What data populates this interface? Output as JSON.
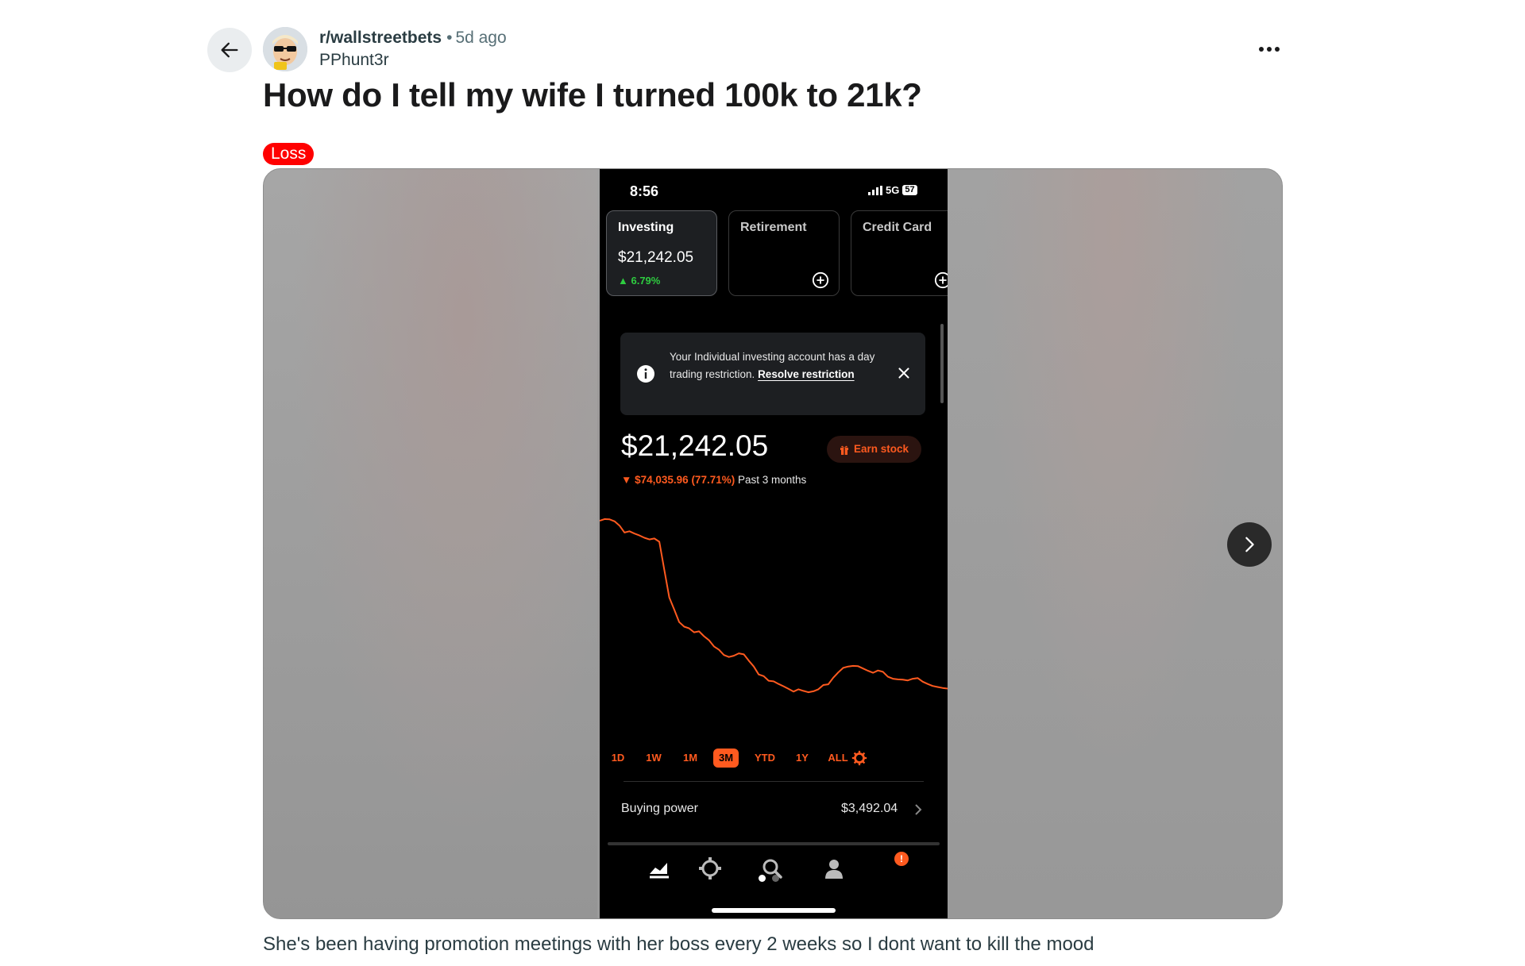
{
  "post": {
    "subreddit": "r/wallstreetbets",
    "separator": "•",
    "time_ago": "5d ago",
    "username": "PPhunt3r",
    "title": "How do I tell my wife I turned 100k to 21k?",
    "flair": "Loss",
    "body": "She's been having promotion meetings with her boss every 2 weeks so I dont want to kill the mood"
  },
  "icons": {
    "back": "arrow-left-icon",
    "more": "more-horizontal-icon",
    "next": "chevron-right-icon"
  },
  "phone": {
    "status_time": "8:56",
    "network": "5G",
    "battery": "57",
    "accounts": [
      {
        "label": "Investing",
        "value": "$21,242.05",
        "change": "▲ 6.79%"
      },
      {
        "label": "Retirement"
      },
      {
        "label": "Credit Card"
      }
    ],
    "notice": {
      "text": "Your Individual investing account has a day trading restriction.",
      "link": "Resolve restriction"
    },
    "balance": "$21,242.05",
    "earn_button": "Earn stock",
    "change_amount": "$74,035.96 (77.71%)",
    "change_period": "Past 3 months",
    "ranges": [
      "1D",
      "1W",
      "1M",
      "3M",
      "YTD",
      "1Y",
      "ALL"
    ],
    "selected_range": "3M",
    "buying_power_label": "Buying power",
    "buying_power_value": "$3,492.04",
    "notification_badge": "!",
    "accent_color": "#ff5a1f",
    "gain_color": "#2ecc40"
  },
  "chart_data": {
    "type": "line",
    "title": "",
    "xlabel": "",
    "ylabel": "",
    "period": "3M",
    "x": [
      0,
      1,
      2,
      3,
      4,
      5,
      6,
      7,
      8,
      9,
      10,
      11,
      12,
      13,
      14,
      15,
      16,
      17,
      18,
      19,
      20,
      21,
      22,
      23,
      24,
      25,
      26,
      27,
      28,
      29,
      30,
      31,
      32,
      33,
      34,
      35,
      36,
      37,
      38,
      39,
      40,
      41,
      42,
      43,
      44,
      45,
      46,
      47,
      48,
      49,
      50,
      51,
      52,
      53,
      54,
      55,
      56,
      57,
      58,
      59,
      60,
      61,
      62,
      63,
      64,
      65,
      66,
      67,
      68,
      69,
      70
    ],
    "values": [
      94.8,
      95.3,
      95.2,
      94.6,
      93.3,
      91.2,
      91.6,
      90.9,
      90.3,
      89.6,
      89.1,
      89.4,
      88.4,
      80.0,
      71.5,
      67.8,
      64.0,
      62.6,
      62.1,
      60.9,
      61.2,
      59.7,
      58.5,
      56.6,
      55.6,
      54.0,
      53.4,
      53.8,
      54.5,
      54.2,
      52.3,
      50.5,
      48.1,
      47.6,
      46.2,
      46.0,
      45.2,
      44.5,
      43.7,
      42.9,
      43.6,
      43.1,
      42.7,
      43.0,
      43.6,
      44.9,
      45.1,
      47.1,
      48.7,
      50.1,
      50.5,
      50.7,
      50.6,
      49.9,
      49.2,
      48.6,
      49.3,
      48.9,
      47.4,
      46.8,
      46.6,
      46.5,
      46.3,
      46.8,
      47.0,
      45.9,
      45.2,
      44.6,
      44.3,
      44.0,
      43.8
    ],
    "unit": "$ thousands",
    "color": "#ff5a1f",
    "grid": false
  }
}
